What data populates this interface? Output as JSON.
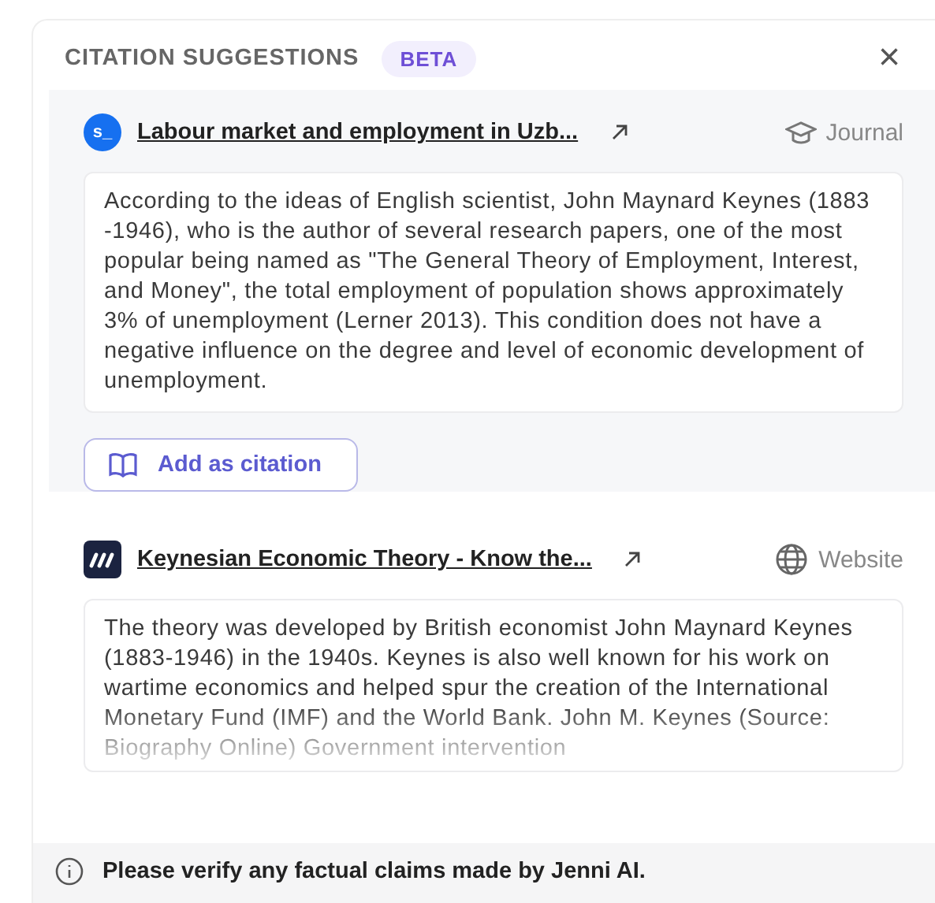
{
  "panel": {
    "title": "CITATION SUGGESTIONS",
    "badge": "BETA",
    "close": "×"
  },
  "sources": [
    {
      "logo": {
        "kind": "circle",
        "text": "s_"
      },
      "title": "Labour market and employment in Uzb...",
      "type": {
        "kind": "journal",
        "label": "Journal"
      },
      "highlighted": true,
      "excerpt": "According to the ideas of English scientist, John Maynard Keynes (1883 -1946), who is the author of several research papers, one of the most popular being named as \"The General Theory of Employment, Interest, and Money\", the total employment of population shows approximately 3% of unemployment (Lerner 2013). This condition does not have a negative influence on the degree and level of economic development of unemployment.",
      "faded": false,
      "button": "Add as citation"
    },
    {
      "logo": {
        "kind": "square"
      },
      "title": "Keynesian Economic Theory - Know the...",
      "type": {
        "kind": "website",
        "label": "Website"
      },
      "highlighted": false,
      "excerpt": "The theory was developed by British economist John Maynard Keynes (1883-1946) in the 1940s. Keynes is also well known for his work on wartime economics and helped spur the creation of the International Monetary Fund (IMF) and the World Bank. John M. Keynes (Source: Biography Online) Government intervention",
      "faded": true
    }
  ],
  "footer": {
    "text": "Please verify any factual claims made by Jenni AI."
  }
}
